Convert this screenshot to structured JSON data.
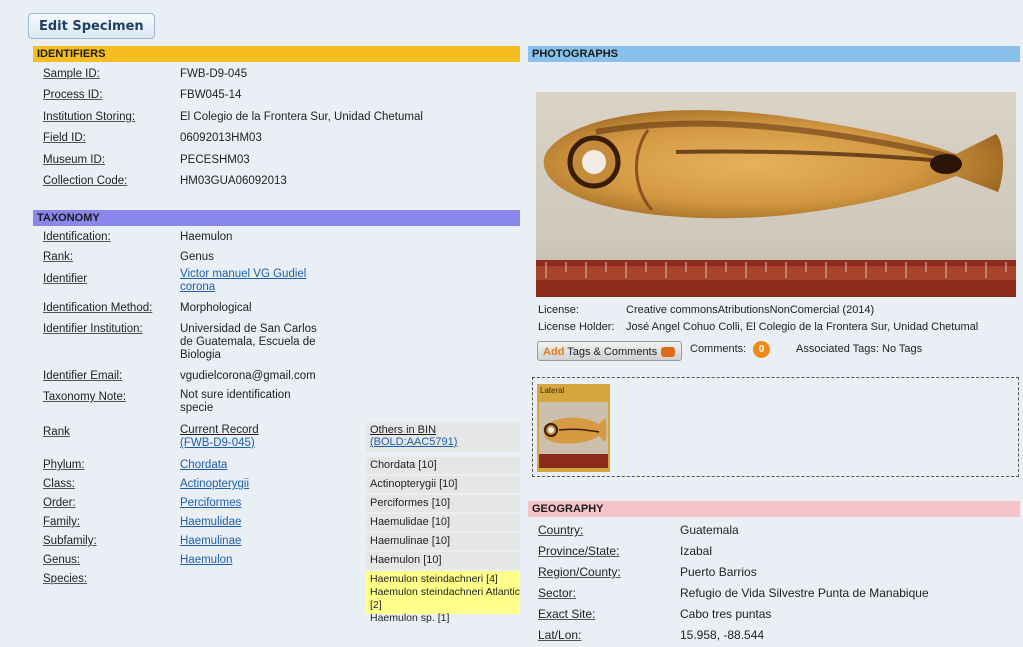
{
  "edit_button": "Edit Specimen",
  "identifiers": {
    "title": "IDENTIFIERS",
    "rows": [
      {
        "label": "Sample ID:",
        "value": "FWB-D9-045"
      },
      {
        "label": "Process ID:",
        "value": "FBW045-14"
      },
      {
        "label": "Institution Storing:",
        "value": "El Colegio de la Frontera Sur, Unidad Chetumal"
      },
      {
        "label": "Field ID:",
        "value": "06092013HM03"
      },
      {
        "label": "Museum ID:",
        "value": "PECESHM03"
      },
      {
        "label": "Collection Code:",
        "value": "HM03GUA06092013"
      }
    ]
  },
  "taxonomy": {
    "title": "TAXONOMY",
    "identification": {
      "label": "Identification:",
      "value": "Haemulon"
    },
    "rank": {
      "label": "Rank:",
      "value": "Genus"
    },
    "identifier": {
      "label": "Identifier",
      "line1": "Victor manuel VG Gudiel",
      "line2": "corona"
    },
    "method": {
      "label": "Identification Method:",
      "value": "Morphological"
    },
    "institution": {
      "label": "Identifier Institution:",
      "line1": "Universidad de San Carlos",
      "line2": "de Guatemala, Escuela de",
      "line3": "Biologia"
    },
    "email": {
      "label": "Identifier Email:",
      "value": "vgudielcorona@gmail.com"
    },
    "note": {
      "label": "Taxonomy Note:",
      "line1": "Not sure identification",
      "line2": "specie"
    },
    "table_head": {
      "rank": "Rank",
      "current_1": "Current Record",
      "current_2": "(FWB-D9-045)",
      "others_1": "Others in BIN",
      "others_2": "(BOLD:AAC5791)"
    },
    "ranks": [
      {
        "label": "Phylum:",
        "current": "Chordata",
        "bin": "Chordata [10]"
      },
      {
        "label": "Class:",
        "current": "Actinopterygii",
        "bin": "Actinopterygii [10]"
      },
      {
        "label": "Order:",
        "current": "Perciformes",
        "bin": "Perciformes [10]"
      },
      {
        "label": "Family:",
        "current": "Haemulidae",
        "bin": "Haemulidae [10]"
      },
      {
        "label": "Subfamily:",
        "current": "Haemulinae",
        "bin": "Haemulinae [10]"
      },
      {
        "label": "Genus:",
        "current": "Haemulon",
        "bin": "Haemulon [10]"
      }
    ],
    "species": {
      "label": "Species:",
      "bins": [
        "Haemulon steindachneri [4]",
        "Haemulon steindachneri Atlantic [2]",
        "Haemulon sp. [1]"
      ]
    }
  },
  "photographs": {
    "title": "PHOTOGRAPHS",
    "license_label": "License:",
    "license_value": "Creative commonsAtributionsNonComercial (2014)",
    "holder_label": "License Holder:",
    "holder_value": "José Angel Cohuo Colli, El Colegio de la Frontera Sur, Unidad Chetumal",
    "add_word": "Add",
    "tags_comments": " Tags & Comments",
    "comments_label": "Comments:",
    "comments_count": "0",
    "associated_tags": "Associated Tags: No Tags",
    "thumb_label": "Lateral"
  },
  "geography": {
    "title": "GEOGRAPHY",
    "rows": [
      {
        "label": "Country:",
        "value": "Guatemala"
      },
      {
        "label": "Province/State:",
        "value": "Izabal"
      },
      {
        "label": "Region/County:",
        "value": "Puerto Barrios"
      },
      {
        "label": "Sector:",
        "value": "Refugio de Vida Silvestre Punta de Manabique"
      },
      {
        "label": "Exact Site:",
        "value": "Cabo tres puntas"
      },
      {
        "label": "Lat/Lon:",
        "value": "15.958, -88.544"
      }
    ]
  },
  "colors": {
    "identifiers": "#f6bd1e",
    "taxonomy": "#8986ec",
    "photographs": "#87c1ec",
    "geography": "#f5c4c9",
    "link": "#1d5fa8",
    "count_badge": "#f08a16"
  },
  "icons": {
    "comment": "speech-bubble-icon"
  }
}
